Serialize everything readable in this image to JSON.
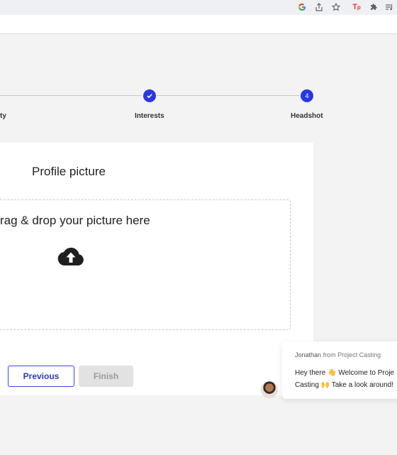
{
  "browser": {
    "icons": [
      "google-icon",
      "share-icon",
      "star-icon",
      "tp-extension-icon",
      "puzzle-icon",
      "reading-list-icon"
    ]
  },
  "stepper": {
    "steps": [
      {
        "label": "ty"
      },
      {
        "label": "Interests",
        "state": "completed"
      },
      {
        "label": "Headshot",
        "number": "4",
        "state": "current"
      }
    ],
    "accent": "#2a38e2"
  },
  "card": {
    "title": "Profile picture",
    "dropzone_text": "rag & drop your picture here",
    "upload_icon": "cloud-upload-icon"
  },
  "buttons": {
    "previous": "Previous",
    "finish": "Finish"
  },
  "chat": {
    "sender": "Jonathan",
    "from_label": "from Project Casting",
    "message_line1": "Hey there 👋 Welcome to Proje",
    "message_line2": "Casting 🙌 Take a look around!"
  }
}
